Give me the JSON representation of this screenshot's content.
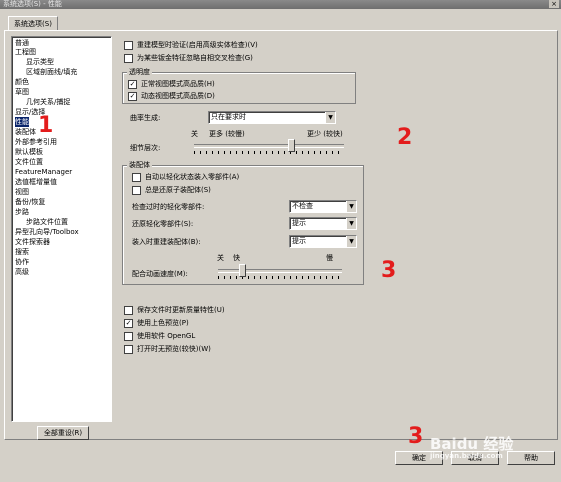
{
  "window": {
    "title": "系统选项(S) - 性能",
    "close_glyph": "×"
  },
  "tab_label": "系统选项(S)",
  "tree_items": [
    "普通",
    "工程图",
    "显示类型",
    "区域剖面线/填充",
    "颜色",
    "草图",
    "几何关系/捕捉",
    "显示/选择",
    "性能",
    "装配体",
    "外部参考引用",
    "默认模板",
    "文件位置",
    "FeatureManager",
    "选值框增量值",
    "视图",
    "备份/恢复",
    "步路",
    "步路文件位置",
    "异型孔向导/Toolbox",
    "文件探索器",
    "搜索",
    "协作",
    "高级"
  ],
  "checks": {
    "rebuild_verify": {
      "label": "重建模型时验证(启用高级实体检查)(V)",
      "checked": false
    },
    "ignore_self_intersect": {
      "label": "为某些钣金特征忽略自相交叉检查(G)",
      "checked": false
    }
  },
  "transparency": {
    "title": "透明度",
    "normal_view": {
      "label": "正常视图模式高品质(H)",
      "checked": true,
      "glyph": "✓"
    },
    "dynamic_view": {
      "label": "动态视图模式高品质(D)",
      "checked": true,
      "glyph": "✓"
    }
  },
  "curvature": {
    "label": "曲率生成:",
    "value": "只在要求时"
  },
  "detail_level": {
    "label": "细节层次:",
    "off_label": "关",
    "more_label": "更多 (较慢)",
    "less_label": "更少 (较快)",
    "level": 0.66
  },
  "assembly": {
    "title": "装配体",
    "auto_lightweight": {
      "label": "自动以轻化状态装入零部件(A)",
      "checked": false
    },
    "always_resolve": {
      "label": "总是还原子装配体(S)",
      "checked": false
    },
    "check_outdated": {
      "label": "检查过时的轻化零部件:",
      "value": "不检查"
    },
    "resolve_lightweight": {
      "label": "还原轻化零部件(S):",
      "value": "提示"
    },
    "rebuild_on_load": {
      "label": "装入时重建装配体(B):",
      "value": "提示"
    },
    "anim_speed": {
      "label": "配合动画速度(M):",
      "off_label": "关",
      "fast_label": "快",
      "slow_label": "慢",
      "level": 0.18
    }
  },
  "bottom_checks": [
    {
      "label": "保存文件时更新质量特性(U)",
      "checked": false
    },
    {
      "label": "使用上色预览(P)",
      "checked": true
    },
    {
      "label": "使用软件 OpenGL",
      "checked": false
    },
    {
      "label": "打开时无预览(较快)(W)",
      "checked": false
    }
  ],
  "buttons": {
    "reset_all": "全部重设(R)",
    "ok": "确定",
    "cancel": "取消",
    "help": "帮助"
  },
  "annotations": [
    "1",
    "2",
    "3",
    "3"
  ],
  "watermark": {
    "brand": "Baidu 经验",
    "url": "jingyan.baidu.com"
  }
}
